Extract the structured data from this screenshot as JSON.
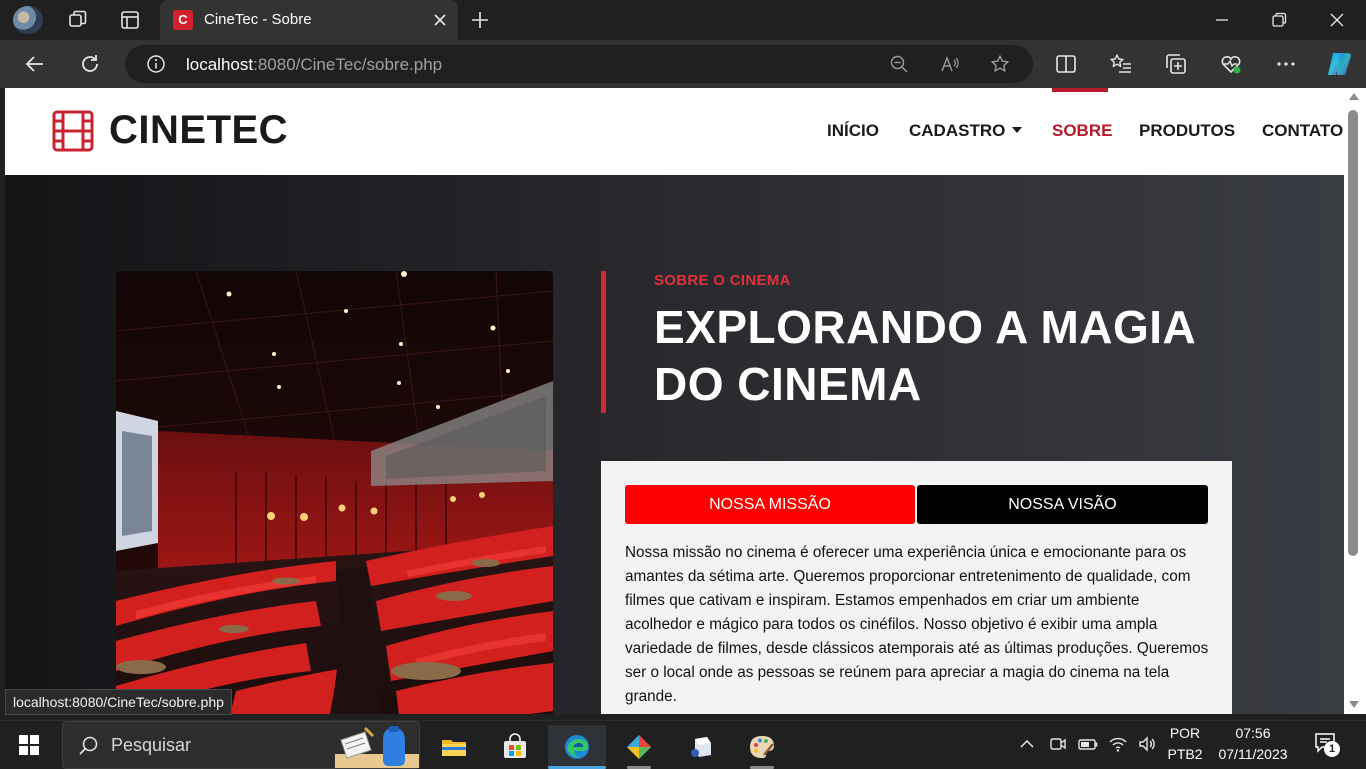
{
  "browser": {
    "tab_title": "CineTec - Sobre",
    "tab_favicon_letter": "C",
    "url_host": "localhost",
    "url_rest": ":8080/CineTec/sobre.php",
    "status_url": "localhost:8080/CineTec/sobre.php"
  },
  "site": {
    "logo_text": "CINETEC",
    "menu": {
      "inicio": "INÍCIO",
      "cadastro": "CADASTRO",
      "sobre": "SOBRE",
      "produtos": "PRODUTOS",
      "contato": "CONTATO"
    },
    "active_menu": "SOBRE"
  },
  "hero": {
    "eyebrow": "SOBRE O CINEMA",
    "title": "EXPLORANDO A MAGIA DO CINEMA",
    "tabs": {
      "mission": "NOSSA MISSÃO",
      "vision": "NOSSA VISÃO"
    },
    "active_tab": "NOSSA MISSÃO",
    "mission_text": "Nossa missão no cinema é oferecer uma experiência única e emocionante para os amantes da sétima arte. Queremos proporcionar entretenimento de qualidade, com filmes que cativam e inspiram. Estamos empenhados em criar um ambiente acolhedor e mágico para todos os cinéfilos. Nosso objetivo é exibir uma ampla variedade de filmes, desde clássicos atemporais até as últimas produções. Queremos ser o local onde as pessoas se reúnem para apreciar a magia do cinema na tela grande."
  },
  "taskbar": {
    "search_placeholder": "Pesquisar",
    "language_top": "POR",
    "language_bottom": "PTB2",
    "time": "07:56",
    "date": "07/11/2023",
    "notification_count": "1"
  },
  "colors": {
    "brand_red": "#b7192a",
    "mission_tab": "#fe0000",
    "vision_tab": "#000000",
    "accent_line": "#d22a33"
  }
}
